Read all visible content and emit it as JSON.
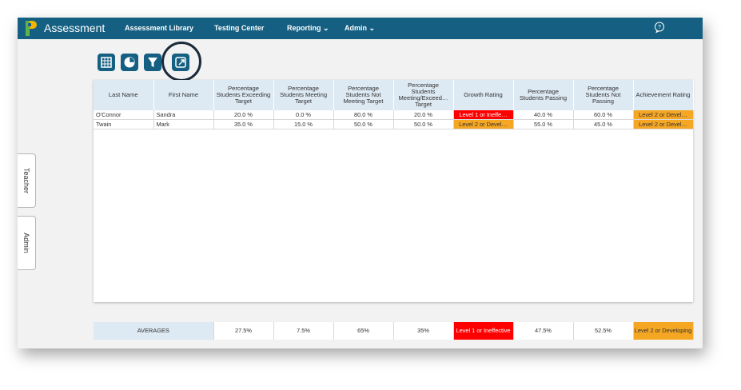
{
  "header": {
    "app_title": "Assessment",
    "nav": [
      {
        "label": "Assessment Library"
      },
      {
        "label": "Testing Center"
      },
      {
        "label": "Reporting ⌄"
      },
      {
        "label": "Admin ⌄"
      }
    ]
  },
  "toolbar": {
    "buttons": [
      "table-view-icon",
      "chart-view-icon",
      "filter-icon",
      "export-icon"
    ]
  },
  "side_tabs": [
    "Teacher",
    "Admin"
  ],
  "table": {
    "columns": [
      "Last Name",
      "First Name",
      "Percentage Students Exceeding Target",
      "Percentage Students Meeting Target",
      "Percentage Students Not Meeting Target",
      "Percentage Students Meeting/Exceed… Target",
      "Growth Rating",
      "Percentage Students Passing",
      "Percentage Students Not Passing",
      "Achievement Rating"
    ],
    "rows": [
      [
        "O'Connor",
        "Sandra",
        "20.0 %",
        "0.0 %",
        "80.0 %",
        "20.0 %",
        "Level 1 or Ineffe…",
        "40.0 %",
        "60.0 %",
        "Level 2 or Devel…"
      ],
      [
        "Twain",
        "Mark",
        "35.0 %",
        "15.0 %",
        "50.0 %",
        "50.0 %",
        "Level 2 or Devel…",
        "55.0 %",
        "45.0 %",
        "Level 2 or Devel…"
      ]
    ]
  },
  "averages": {
    "label": "AVERAGES",
    "values": [
      "27.5%",
      "7.5%",
      "65%",
      "35%",
      "Level 1 or Ineffective",
      "47.5%",
      "52.5%",
      "Level 2 or Developing"
    ]
  },
  "colors": {
    "topbar": "#156082",
    "header_bg": "#dde9f3",
    "level1": "#ff0000",
    "level2": "#f5a623"
  }
}
